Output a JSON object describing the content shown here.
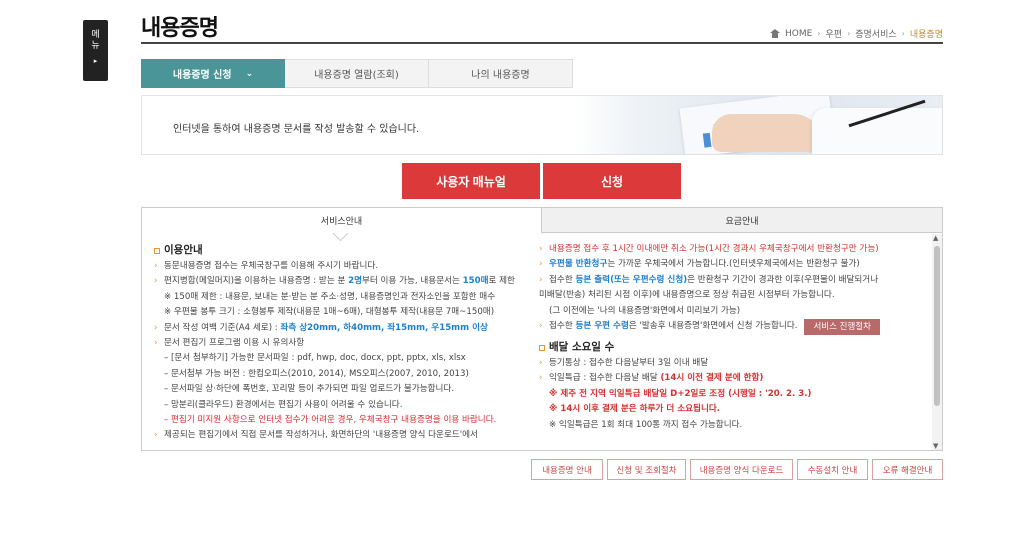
{
  "side_menu": {
    "label": "메뉴",
    "arrow": "▸"
  },
  "page": {
    "title": "내용증명"
  },
  "breadcrumb": {
    "home": "HOME",
    "items": [
      "우편",
      "증명서비스"
    ],
    "current": "내용증명",
    "sep": "›"
  },
  "tabs": [
    {
      "label": "내용증명 신청",
      "active": true,
      "chev": "⌄"
    },
    {
      "label": "내용증명 열람(조회)",
      "active": false
    },
    {
      "label": "나의 내용증명",
      "active": false
    }
  ],
  "banner": {
    "text": "인터넷을 통하여 내용증명 문서를 작성 발송할 수 있습니다."
  },
  "buttons": {
    "manual": "사용자 매뉴얼",
    "apply": "신청"
  },
  "info_tabs": {
    "service": "서비스안내",
    "fee": "요금안내"
  },
  "left": {
    "heading": "이용안내",
    "marker": "›",
    "l1": "동문내용증명 접수는 우체국창구를 이용해 주시기 바랍니다.",
    "l2a": "편지병합(메일머지)을 이용하는 내용증명 : 받는 분 ",
    "l2b": "2명",
    "l2c": "부터 이용 가능, 내용문서는 ",
    "l2d": "150매",
    "l2e": "로 제한",
    "l3": "※ 150매 제한 : 내용문, 보내는 분·받는 분 주소·성명, 내용증명인과 전자소인을 포함한 매수",
    "l4": "※ 우편물 봉투 크기 : 소형봉투 제작(내용문 1매~6매), 대형봉투 제작(내용문 7매~150매)",
    "l5a": "문서 작성 여백 기준(A4 세로) : ",
    "l5b": "좌측 상20mm, 하40mm, 좌15mm, 우15mm 이상",
    "l6": "문서 편집기 프로그램 이용 시 유의사항",
    "l7": "– [문서 첨부하기] 가능한 문서파일 : pdf, hwp, doc, docx, ppt, pptx, xls, xlsx",
    "l8": "– 문서첨부 가능 버전 : 한컴오피스(2010, 2014), MS오피스(2007, 2010, 2013)",
    "l9": "– 문서파일 상·하단에 폭번호, 꼬리말 등이 추가되면 파일 업로드가 불가능합니다.",
    "l10": "– 망분리(클라우드) 환경에서는 편집기 사용이 어려울 수 있습니다.",
    "l11": "– 편집기 미지원 사항으로 인터넷 접수가 어려운 경우, 우체국창구 내용증명을 이용 바랍니다.",
    "l12": "제공되는 편집기에서 직접 문서를 작성하거나, 화면하단의 '내용증명 양식 다운로드'에서"
  },
  "right": {
    "marker": "›",
    "r1": "내용증명 접수 후 1시간 이내에만 취소 가능(1시간 경과시 우체국창구에서 반환청구만 가능)",
    "r2a": "우편물 반환청구",
    "r2b": "는 가까운 우체국에서 가능합니다.(인터넷우체국에서는 반환청구 불가)",
    "r3a": "접수한 ",
    "r3b": "등본 출력(또는 우편수령 신청)",
    "r3c": "은 반환청구 기간이 경과한 이후(우편물이 배달되거나",
    "r4": "미배달(반송) 처리된 시점 이후)에 내용증명으로 정상 취급된 시점부터 가능합니다.",
    "r5": "(그 이전에는 '나의 내용증명'화면에서 미리보기 가능)",
    "r6a": "접수한 ",
    "r6b": "등본 우편 수령",
    "r6c": "은 '발송후 내용증명'화면에서 신청 가능합니다.",
    "r6btn": "서비스 진행절차",
    "heading": "배달 소요일 수",
    "r7": "등기통상 : 접수한 다음날부터 3일 이내 배달",
    "r8a": "익일특급 : 접수한 다음날 배달 ",
    "r8b": "(14시 이전 결제 분에 한함)",
    "r9": "※ 제주 전 지역 익일특급 배달일 D+2일로 조정 (시행일 : '20. 2. 3.)",
    "r10": "※ 14시 이후 결제 분은 하루가 더 소요됩니다.",
    "r11": "※ 익일특급은 1회 최대 100통 까지 접수 가능합니다."
  },
  "footer_buttons": [
    "내용증명 안내",
    "신청 및 조회절차",
    "내용증명 양식 다운로드",
    "수동설치 안내",
    "오류 해결안내"
  ],
  "scroll": {
    "up": "▲",
    "down": "▼"
  },
  "colors": {
    "teal": "#4a9598",
    "red": "#dc3a3a",
    "accent_orange": "#e39b2a",
    "blue": "#1e7fd0"
  }
}
